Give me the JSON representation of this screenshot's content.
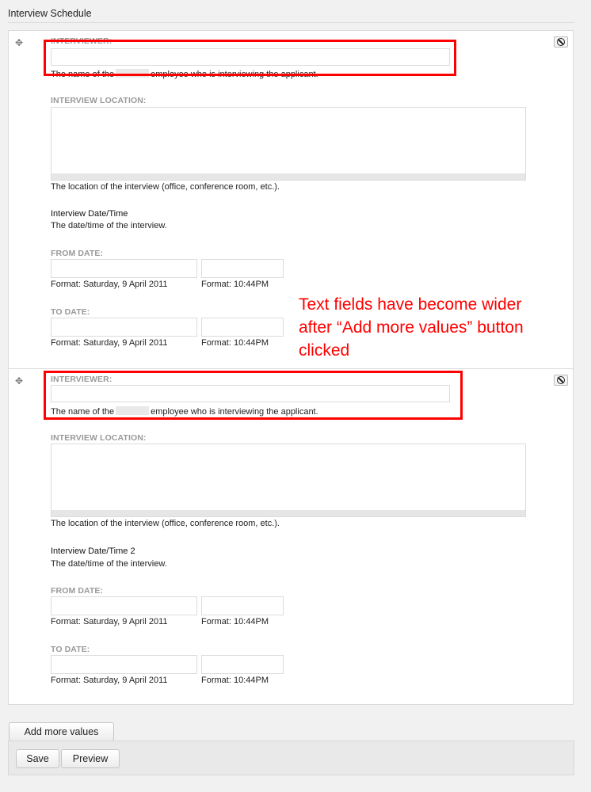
{
  "section_title": "Interview Schedule",
  "annotation": {
    "color": "#ff0000",
    "note_lines": [
      "Text fields have become wider",
      "after “Add more values” button",
      "clicked"
    ]
  },
  "entries": [
    {
      "interviewer_label": "INTERVIEWER:",
      "interviewer_value": "",
      "interviewer_desc_prefix": "The name of the",
      "interviewer_desc_suffix": "employee who is interviewing the applicant.",
      "location_label": "INTERVIEW LOCATION:",
      "location_value": "",
      "location_desc": "The location of the interview (office, conference room, etc.).",
      "datetime_title": "Interview Date/Time",
      "datetime_desc": "The date/time of the interview.",
      "from_label": "FROM DATE:",
      "from_date_format": "Format: Saturday, 9 April 2011",
      "from_time_format": "Format: 10:44PM",
      "to_label": "TO DATE:",
      "to_date_format": "Format: Saturday, 9 April 2011",
      "to_time_format": "Format: 10:44PM"
    },
    {
      "interviewer_label": "INTERVIEWER:",
      "interviewer_value": "",
      "interviewer_desc_prefix": "The name of the",
      "interviewer_desc_suffix": "employee who is interviewing the applicant.",
      "location_label": "INTERVIEW LOCATION:",
      "location_value": "",
      "location_desc": "The location of the interview (office, conference room, etc.).",
      "datetime_title": "Interview Date/Time 2",
      "datetime_desc": "The date/time of the interview.",
      "from_label": "FROM DATE:",
      "from_date_format": "Format: Saturday, 9 April 2011",
      "from_time_format": "Format: 10:44PM",
      "to_label": "TO DATE:",
      "to_date_format": "Format: Saturday, 9 April 2011",
      "to_time_format": "Format: 10:44PM"
    }
  ],
  "buttons": {
    "add_more": "Add more values",
    "save": "Save",
    "preview": "Preview"
  },
  "icons": {
    "drag": "drag-move-icon",
    "remove": "remove-ban-icon"
  }
}
